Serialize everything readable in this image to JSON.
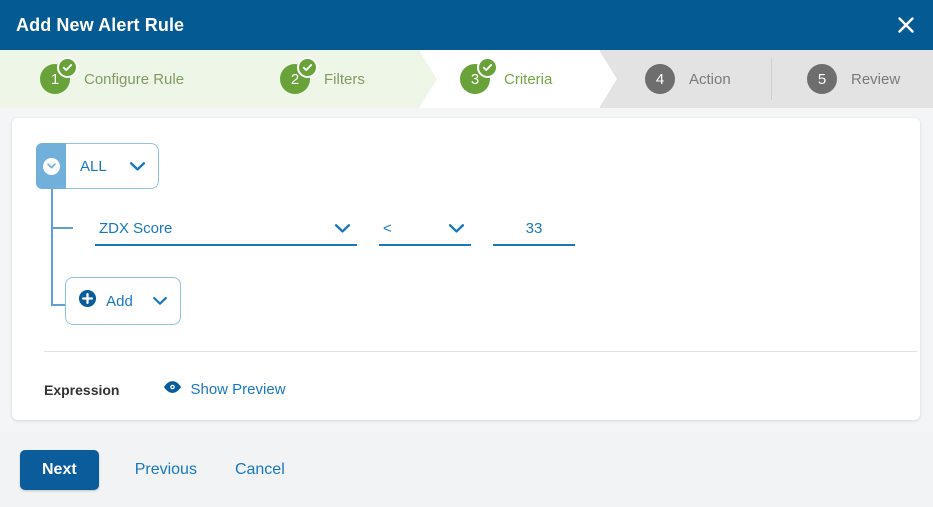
{
  "dialog": {
    "title": "Add New Alert Rule",
    "close_icon": "close-icon"
  },
  "stepper": {
    "steps": [
      {
        "number": "1",
        "label": "Configure Rule",
        "state": "done"
      },
      {
        "number": "2",
        "label": "Filters",
        "state": "done"
      },
      {
        "number": "3",
        "label": "Criteria",
        "state": "active"
      },
      {
        "number": "4",
        "label": "Action",
        "state": "todo"
      },
      {
        "number": "5",
        "label": "Review",
        "state": "todo"
      }
    ],
    "colors": {
      "done_bg": "#eef7e7",
      "done_circle": "#68a239",
      "active_bg": "#ffffff",
      "todo_bg": "#e3e3e3",
      "todo_circle": "#6e6e6e"
    }
  },
  "criteria": {
    "group": {
      "operator": "ALL",
      "handle_icon": "collapse-caret-icon",
      "caret_icon": "chevron-down-icon"
    },
    "condition": {
      "metric": "ZDX Score",
      "metric_caret_icon": "chevron-down-icon",
      "operator": "<",
      "operator_caret_icon": "chevron-down-icon",
      "value": "33"
    },
    "add": {
      "label": "Add",
      "plus_icon": "plus-circle-icon",
      "caret_icon": "chevron-down-icon"
    },
    "expression": {
      "label": "Expression",
      "preview_label": "Show Preview",
      "preview_icon": "eye-icon"
    }
  },
  "footer": {
    "next_label": "Next",
    "previous_label": "Previous",
    "cancel_label": "Cancel"
  },
  "colors": {
    "header_blue": "#045a93",
    "accent_blue": "#1878bd",
    "green": "#68a239",
    "page_bg": "#f4f5f6"
  }
}
